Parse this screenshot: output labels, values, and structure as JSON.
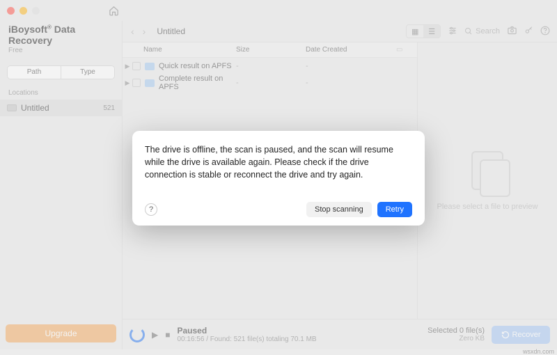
{
  "app": {
    "title": "iBoysoft",
    "title_suffix": " Data Recovery",
    "registered": "®",
    "plan": "Free"
  },
  "sidebar": {
    "tabs": {
      "path": "Path",
      "type": "Type"
    },
    "locations_label": "Locations",
    "items": [
      {
        "name": "Untitled",
        "count": "521"
      }
    ],
    "upgrade": "Upgrade"
  },
  "toolbar": {
    "breadcrumb": "Untitled",
    "search_placeholder": "Search"
  },
  "columns": {
    "name": "Name",
    "size": "Size",
    "date": "Date Created"
  },
  "rows": [
    {
      "name": "Quick result on APFS",
      "size": "-",
      "date": "-"
    },
    {
      "name": "Complete result on APFS",
      "size": "-",
      "date": "-"
    }
  ],
  "preview": {
    "placeholder": "Please select a file to preview"
  },
  "footer": {
    "state": "Paused",
    "detail": "00:16:56 / Found: 521 file(s) totaling 70.1 MB",
    "selected_label": "Selected 0 file(s)",
    "selected_size": "Zero KB",
    "recover": "Recover"
  },
  "dialog": {
    "message": "The drive is offline, the scan is paused, and the scan will resume while the drive is available again. Please check if the drive connection is stable or reconnect the drive and try again.",
    "stop": "Stop scanning",
    "retry": "Retry",
    "help": "?"
  },
  "watermark": "wsxdn.com"
}
